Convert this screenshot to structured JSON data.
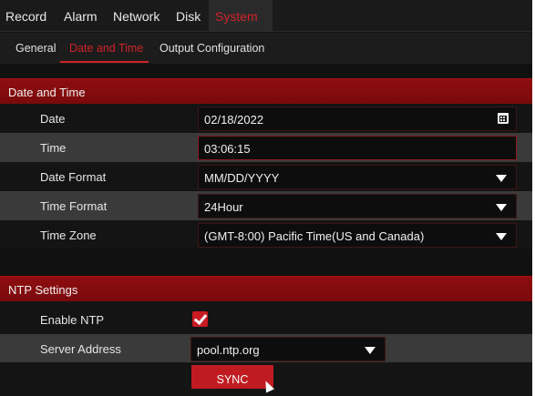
{
  "top_tabs": [
    {
      "label": "Record"
    },
    {
      "label": "Alarm"
    },
    {
      "label": "Network"
    },
    {
      "label": "Disk"
    },
    {
      "label": "System",
      "active": true
    }
  ],
  "sub_tabs": [
    {
      "label": "General"
    },
    {
      "label": "Date and Time",
      "active": true
    },
    {
      "label": "Output Configuration"
    }
  ],
  "date_time": {
    "header": "Date and Time",
    "date": {
      "label": "Date",
      "value": "02/18/2022",
      "icon": "calendar-icon"
    },
    "time": {
      "label": "Time",
      "value": "03:06:15"
    },
    "date_format": {
      "label": "Date Format",
      "value": "MM/DD/YYYY"
    },
    "time_format": {
      "label": "Time Format",
      "value": "24Hour"
    },
    "time_zone": {
      "label": "Time Zone",
      "value": "(GMT-8:00) Pacific Time(US and Canada)"
    }
  },
  "ntp": {
    "header": "NTP Settings",
    "enable": {
      "label": "Enable NTP",
      "checked": true
    },
    "server": {
      "label": "Server Address",
      "value": "pool.ntp.org"
    },
    "sync_label": "SYNC"
  },
  "colors": {
    "accent": "#d0232a",
    "header_bg": "#8e0d10",
    "panel_bg": "#141414",
    "row_alt_bg": "#3a3a3a"
  }
}
